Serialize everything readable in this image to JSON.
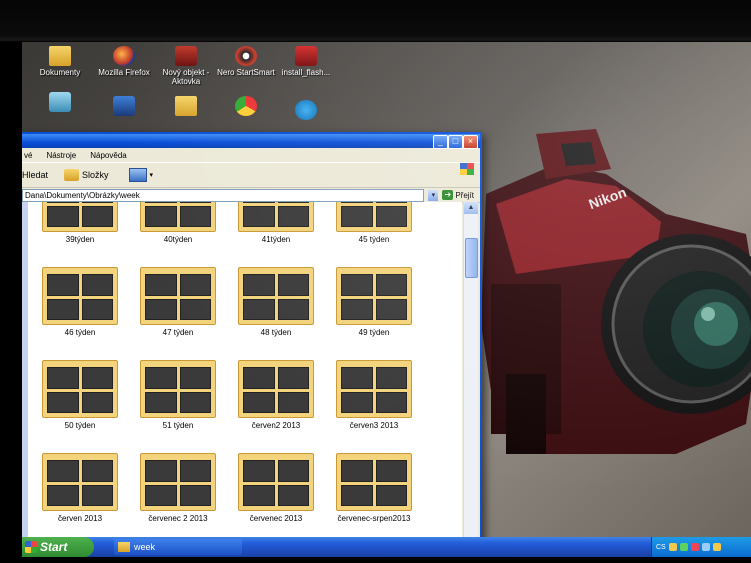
{
  "desktop": {
    "icons": [
      {
        "label": "Dokumenty",
        "icon": "folder-icon"
      },
      {
        "label": "Mozilla Firefox",
        "icon": "firefox-icon"
      },
      {
        "label": "Nový objekt - Aktovka",
        "icon": "briefcase-icon"
      },
      {
        "label": "Nero StartSmart",
        "icon": "nero-icon"
      },
      {
        "label": "install_flash...",
        "icon": "flash-installer-icon"
      }
    ]
  },
  "window": {
    "menu": [
      "vé",
      "Nástroje",
      "Nápověda"
    ],
    "toolbar": {
      "search": "Hledat",
      "folders": "Složky"
    },
    "address": "Dana\\Dokumenty\\Obrázky\\week",
    "go_label": "Přejít",
    "folders": [
      {
        "name": "39týden"
      },
      {
        "name": "40týden"
      },
      {
        "name": "41týden"
      },
      {
        "name": "45 týden"
      },
      {
        "name": "46 týden"
      },
      {
        "name": "47 týden"
      },
      {
        "name": "48 týden"
      },
      {
        "name": "49 týden"
      },
      {
        "name": "50 týden"
      },
      {
        "name": "51 týden"
      },
      {
        "name": "červen2 2013"
      },
      {
        "name": "červen3 2013"
      },
      {
        "name": "červen 2013"
      },
      {
        "name": "červenec 2 2013"
      },
      {
        "name": "červenec 2013"
      },
      {
        "name": "červenec-srpen2013"
      }
    ]
  },
  "taskbar": {
    "start_label": "Start",
    "task_label": "week",
    "tray_lang": "CS"
  }
}
